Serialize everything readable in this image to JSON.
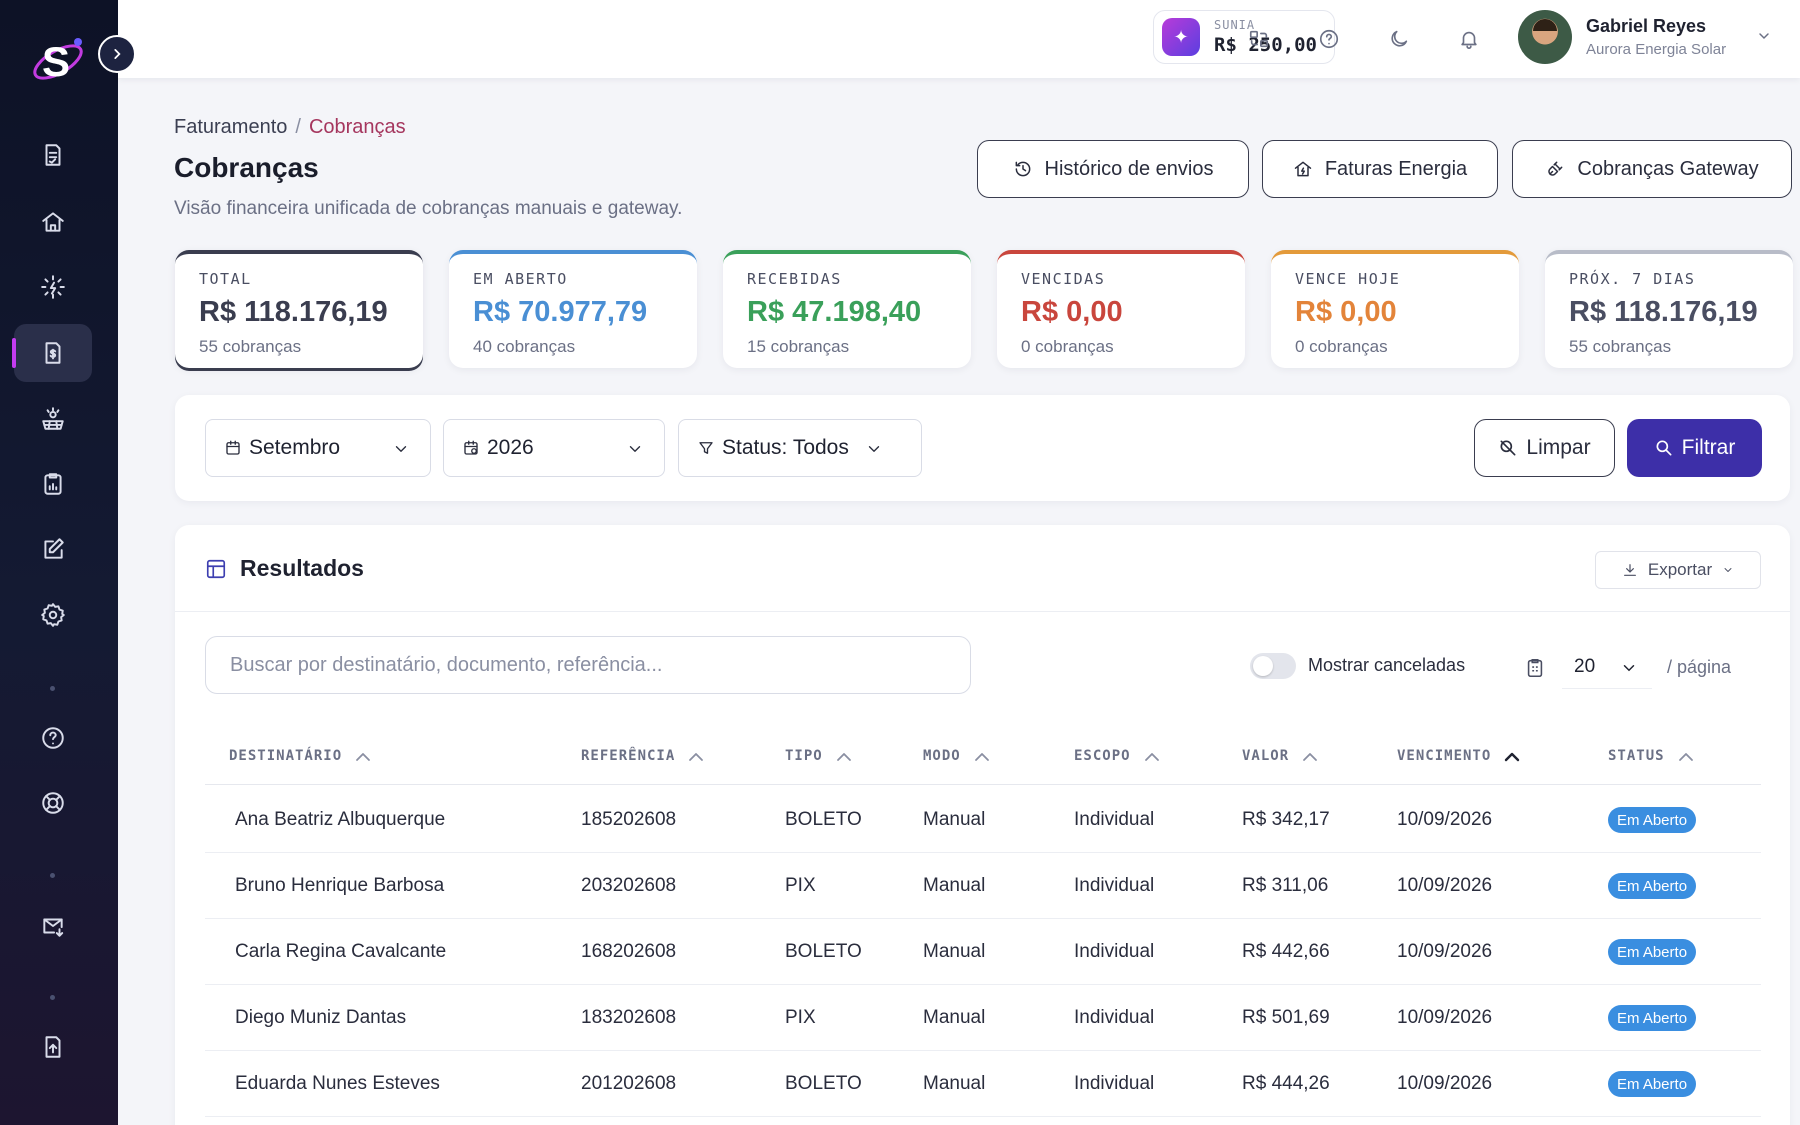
{
  "header": {
    "credit_label": "SUNIA",
    "credit_value": "R$ 250,00",
    "user_name": "Gabriel Reyes",
    "user_org": "Aurora Energia Solar"
  },
  "breadcrumb": {
    "parent": "Faturamento",
    "separator": "/",
    "current": "Cobranças"
  },
  "page": {
    "title": "Cobranças",
    "subtitle": "Visão financeira unificada de cobranças manuais e gateway."
  },
  "actions": {
    "history": "Histórico de envios",
    "energy": "Faturas Energia",
    "gateway": "Cobranças Gateway"
  },
  "stats": [
    {
      "label": "TOTAL",
      "value": "R$ 118.176,19",
      "count": "55 cobranças",
      "color": "#3a3d4f",
      "value_color": "#3a3d4f"
    },
    {
      "label": "EM ABERTO",
      "value": "R$ 70.977,79",
      "count": "40 cobranças",
      "color": "#4a8fd4",
      "value_color": "#4a8fd4"
    },
    {
      "label": "RECEBIDAS",
      "value": "R$ 47.198,40",
      "count": "15 cobranças",
      "color": "#3aa05a",
      "value_color": "#3aa05a"
    },
    {
      "label": "VENCIDAS",
      "value": "R$ 0,00",
      "count": "0 cobranças",
      "color": "#c9463d",
      "value_color": "#c9463d"
    },
    {
      "label": "VENCE HOJE",
      "value": "R$ 0,00",
      "count": "0 cobranças",
      "color": "#e39a3a",
      "value_color": "#e3843a"
    },
    {
      "label": "PRÓX. 7 DIAS",
      "value": "R$ 118.176,19",
      "count": "55 cobranças",
      "color": "#b8bcc8",
      "value_color": "#4a4e62"
    }
  ],
  "filters": {
    "month": "Setembro",
    "year": "2026",
    "status": "Status: Todos",
    "clear": "Limpar",
    "apply": "Filtrar"
  },
  "results": {
    "title": "Resultados",
    "export": "Exportar",
    "search_placeholder": "Buscar por destinatário, documento, referência...",
    "show_canceled": "Mostrar canceladas",
    "show_canceled_on": false,
    "page_size": "20",
    "page_suffix": "/ página",
    "columns": [
      "DESTINATÁRIO",
      "REFERÊNCIA",
      "TIPO",
      "MODO",
      "ESCOPO",
      "VALOR",
      "VENCIMENTO",
      "STATUS"
    ],
    "sorted_column": "VENCIMENTO",
    "rows": [
      {
        "recipient": "Ana Beatriz Albuquerque",
        "reference": "185202608",
        "type": "BOLETO",
        "mode": "Manual",
        "scope": "Individual",
        "value": "R$ 342,17",
        "due": "10/09/2026",
        "status": "Em Aberto"
      },
      {
        "recipient": "Bruno Henrique Barbosa",
        "reference": "203202608",
        "type": "PIX",
        "mode": "Manual",
        "scope": "Individual",
        "value": "R$ 311,06",
        "due": "10/09/2026",
        "status": "Em Aberto"
      },
      {
        "recipient": "Carla Regina Cavalcante",
        "reference": "168202608",
        "type": "BOLETO",
        "mode": "Manual",
        "scope": "Individual",
        "value": "R$ 442,66",
        "due": "10/09/2026",
        "status": "Em Aberto"
      },
      {
        "recipient": "Diego Muniz Dantas",
        "reference": "183202608",
        "type": "PIX",
        "mode": "Manual",
        "scope": "Individual",
        "value": "R$ 501,69",
        "due": "10/09/2026",
        "status": "Em Aberto"
      },
      {
        "recipient": "Eduarda Nunes Esteves",
        "reference": "201202608",
        "type": "BOLETO",
        "mode": "Manual",
        "scope": "Individual",
        "value": "R$ 444,26",
        "due": "10/09/2026",
        "status": "Em Aberto"
      }
    ]
  },
  "sidebar": {
    "icons": [
      "document-icon",
      "home-icon",
      "solar-icon",
      "invoice-icon",
      "solar-panel-icon",
      "report-icon",
      "edit-icon",
      "settings-icon",
      "help-icon",
      "support-icon",
      "mail-icon",
      "upload-icon"
    ]
  }
}
